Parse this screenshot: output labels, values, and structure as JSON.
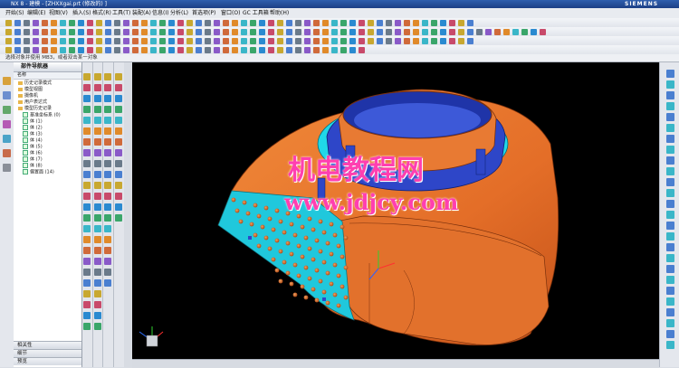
{
  "app": {
    "title": "NX 8 - 建模 - [ZHXXgai.prt (修改的) ]",
    "brand": "SIEMENS"
  },
  "menu": [
    "开始(S)",
    "编辑(E)",
    "视图(V)",
    "插入(S)",
    "格式(R)",
    "工具(T)",
    "装配(A)",
    "信息(I)",
    "分析(L)",
    "首选项(P)",
    "窗口(O)",
    "GC 工具箱",
    "帮助(H)"
  ],
  "status": {
    "selection_prompt": "选择对象并使用 MB3，或者双击某一对象"
  },
  "navigator": {
    "title": "部件导航器",
    "column_name": "名称",
    "items": [
      {
        "label": "历史记录模式",
        "indent": 1
      },
      {
        "label": "模型视图",
        "indent": 1
      },
      {
        "label": "摄像机",
        "indent": 1
      },
      {
        "label": "用户表达式",
        "indent": 1
      },
      {
        "label": "模型历史记录",
        "indent": 1
      },
      {
        "label": "基准坐标系 (0)",
        "indent": 2
      },
      {
        "label": "体 (1)",
        "indent": 2
      },
      {
        "label": "体 (2)",
        "indent": 2
      },
      {
        "label": "体 (3)",
        "indent": 2
      },
      {
        "label": "体 (4)",
        "indent": 2
      },
      {
        "label": "体 (5)",
        "indent": 2
      },
      {
        "label": "体 (6)",
        "indent": 2
      },
      {
        "label": "体 (7)",
        "indent": 2
      },
      {
        "label": "体 (8)",
        "indent": 2
      },
      {
        "label": "偏置面 (14)",
        "indent": 2
      }
    ],
    "footers": [
      "相关性",
      "细节",
      "预览"
    ]
  },
  "watermark": {
    "chinese": "机电教程网",
    "url": "www.jdjcy.com"
  },
  "colors": {
    "model_orange": "#e8742c",
    "model_cyan": "#20d8e8",
    "model_blue": "#2e46c8",
    "background": "#000000",
    "watermark": "#ff3fb0"
  }
}
